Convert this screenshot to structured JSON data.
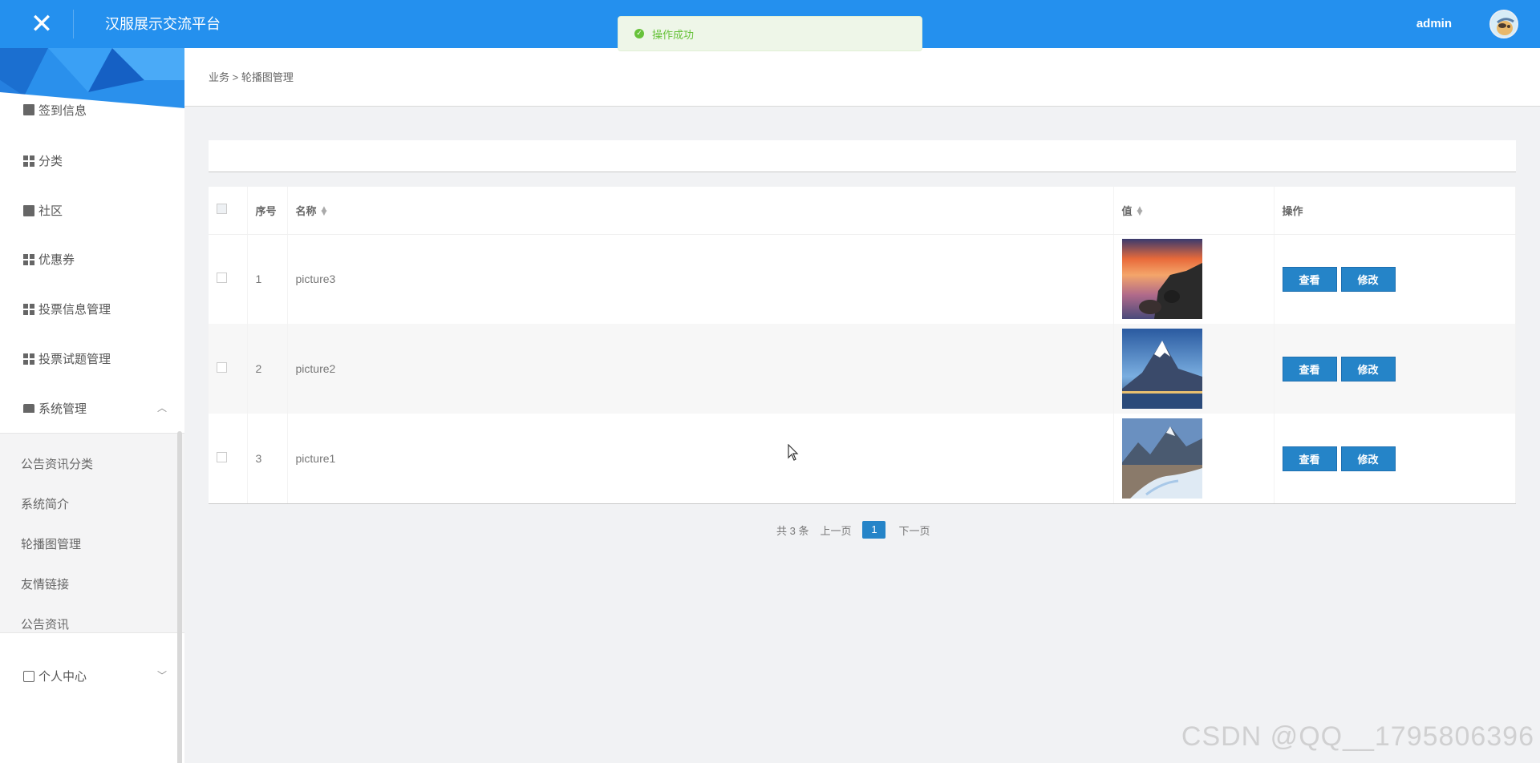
{
  "header": {
    "close_icon": "close-icon",
    "app_title": "汉服展示交流平台",
    "user_name": "admin",
    "brand_color": "#2490ee"
  },
  "toast": {
    "message": "操作成功",
    "icon": "check-circle-icon",
    "color": "#67c23a"
  },
  "sidebar": {
    "items": [
      {
        "label": "签到信息",
        "icon": "grid-icon"
      },
      {
        "label": "分类",
        "icon": "grid-icon"
      },
      {
        "label": "社区",
        "icon": "book-icon"
      },
      {
        "label": "优惠券",
        "icon": "grid-icon"
      },
      {
        "label": "投票信息管理",
        "icon": "grid-icon"
      },
      {
        "label": "投票试题管理",
        "icon": "grid-icon"
      },
      {
        "label": "系统管理",
        "icon": "server-icon",
        "expanded": true
      },
      {
        "label": "个人中心",
        "icon": "card-icon",
        "expanded": false
      }
    ],
    "system_sub_items": [
      {
        "label": "公告资讯分类"
      },
      {
        "label": "系统简介"
      },
      {
        "label": "轮播图管理"
      },
      {
        "label": "友情链接"
      },
      {
        "label": "公告资讯"
      }
    ]
  },
  "breadcrumb": {
    "text": "业务 > 轮播图管理"
  },
  "table": {
    "headers": {
      "index": "序号",
      "name": "名称",
      "value": "值",
      "actions": "操作"
    },
    "rows": [
      {
        "index": "1",
        "name": "picture3",
        "image": "sunset-rocks"
      },
      {
        "index": "2",
        "name": "picture2",
        "image": "mountain-lake"
      },
      {
        "index": "3",
        "name": "picture1",
        "image": "snowy-river"
      }
    ],
    "view_label": "查看",
    "edit_label": "修改"
  },
  "pager": {
    "total": "共 3 条",
    "prev": "上一页",
    "current": "1",
    "next": "下一页"
  },
  "watermark": "CSDN @QQ__1795806396"
}
